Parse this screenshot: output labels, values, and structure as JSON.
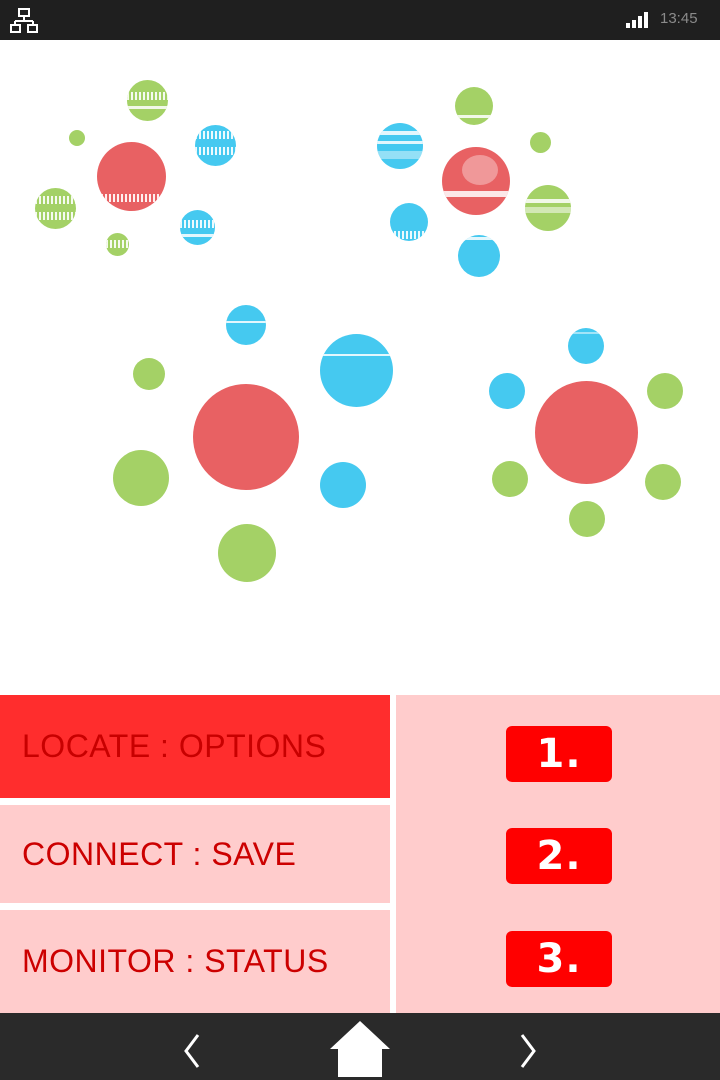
{
  "statusbar": {
    "time": "13:45",
    "icons": [
      "network-icon",
      "signal-icon"
    ]
  },
  "menu": {
    "items": [
      {
        "label": "LOCATE : OPTIONS",
        "active": true
      },
      {
        "label": "CONNECT : SAVE",
        "active": false
      },
      {
        "label": "MONITOR : STATUS",
        "active": false
      }
    ],
    "numbers": [
      "1.",
      "2.",
      "3."
    ]
  },
  "navbar": {
    "icons": [
      "back-chevron-icon",
      "home-icon",
      "forward-chevron-icon"
    ]
  },
  "colors": {
    "red": "#e86163",
    "blue": "#45c9f0",
    "green": "#a4d166",
    "menu_active": "#ff2d2d",
    "menu_bg": "#ffcccc",
    "button": "#ff0000"
  }
}
